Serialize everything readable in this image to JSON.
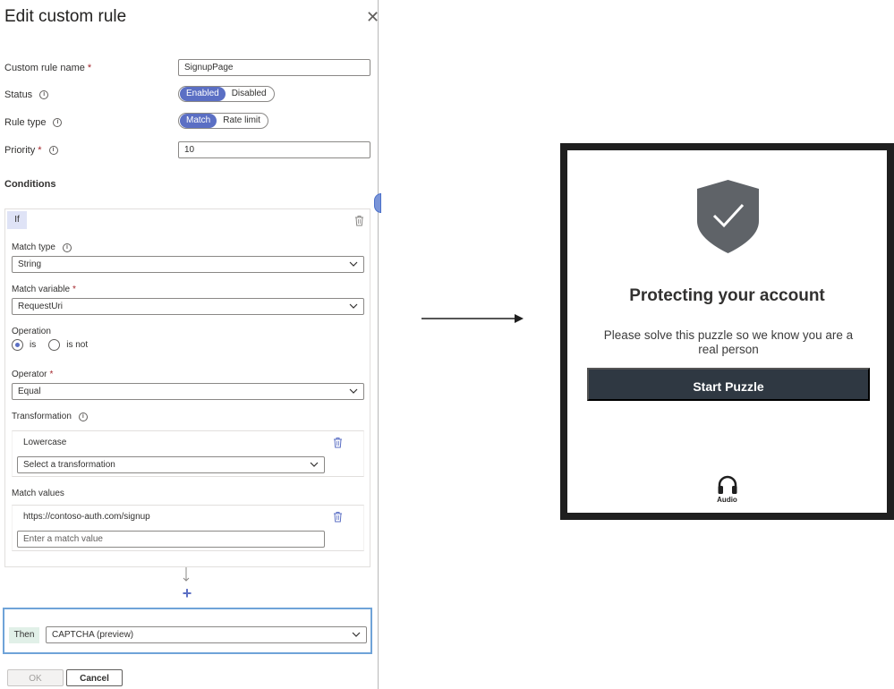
{
  "panel": {
    "title": "Edit custom rule",
    "custom_rule_name": {
      "label": "Custom rule name",
      "required": "*",
      "value": "SignupPage"
    },
    "status": {
      "label": "Status",
      "options": [
        "Enabled",
        "Disabled"
      ],
      "selected": "Enabled"
    },
    "rule_type": {
      "label": "Rule type",
      "options": [
        "Match",
        "Rate limit"
      ],
      "selected": "Match"
    },
    "priority": {
      "label": "Priority",
      "required": "*",
      "value": "10"
    },
    "conditions_title": "Conditions",
    "condition": {
      "badge": "If",
      "match_type": {
        "label": "Match type",
        "value": "String"
      },
      "match_variable": {
        "label": "Match variable",
        "required": "*",
        "value": "RequestUri"
      },
      "operation": {
        "label": "Operation",
        "options": [
          "is",
          "is not"
        ],
        "selected": "is"
      },
      "operator": {
        "label": "Operator",
        "required": "*",
        "value": "Equal"
      },
      "transformation": {
        "label": "Transformation",
        "items": [
          "Lowercase"
        ],
        "placeholder": "Select a transformation"
      },
      "match_values": {
        "label": "Match values",
        "items": [
          "https://contoso-auth.com/signup"
        ],
        "placeholder": "Enter a match value"
      }
    },
    "then": {
      "badge": "Then",
      "value": "CAPTCHA (preview)"
    },
    "buttons": {
      "ok": "OK",
      "cancel": "Cancel"
    }
  },
  "captcha": {
    "title": "Protecting your account",
    "text": "Please solve this puzzle so we know you are a real person",
    "button": "Start Puzzle",
    "audio_label": "Audio"
  },
  "colors": {
    "accent": "#5b6fc4",
    "captcha_button": "#2f3842",
    "shield": "#5f6368",
    "then_border": "#6fa3d8"
  }
}
